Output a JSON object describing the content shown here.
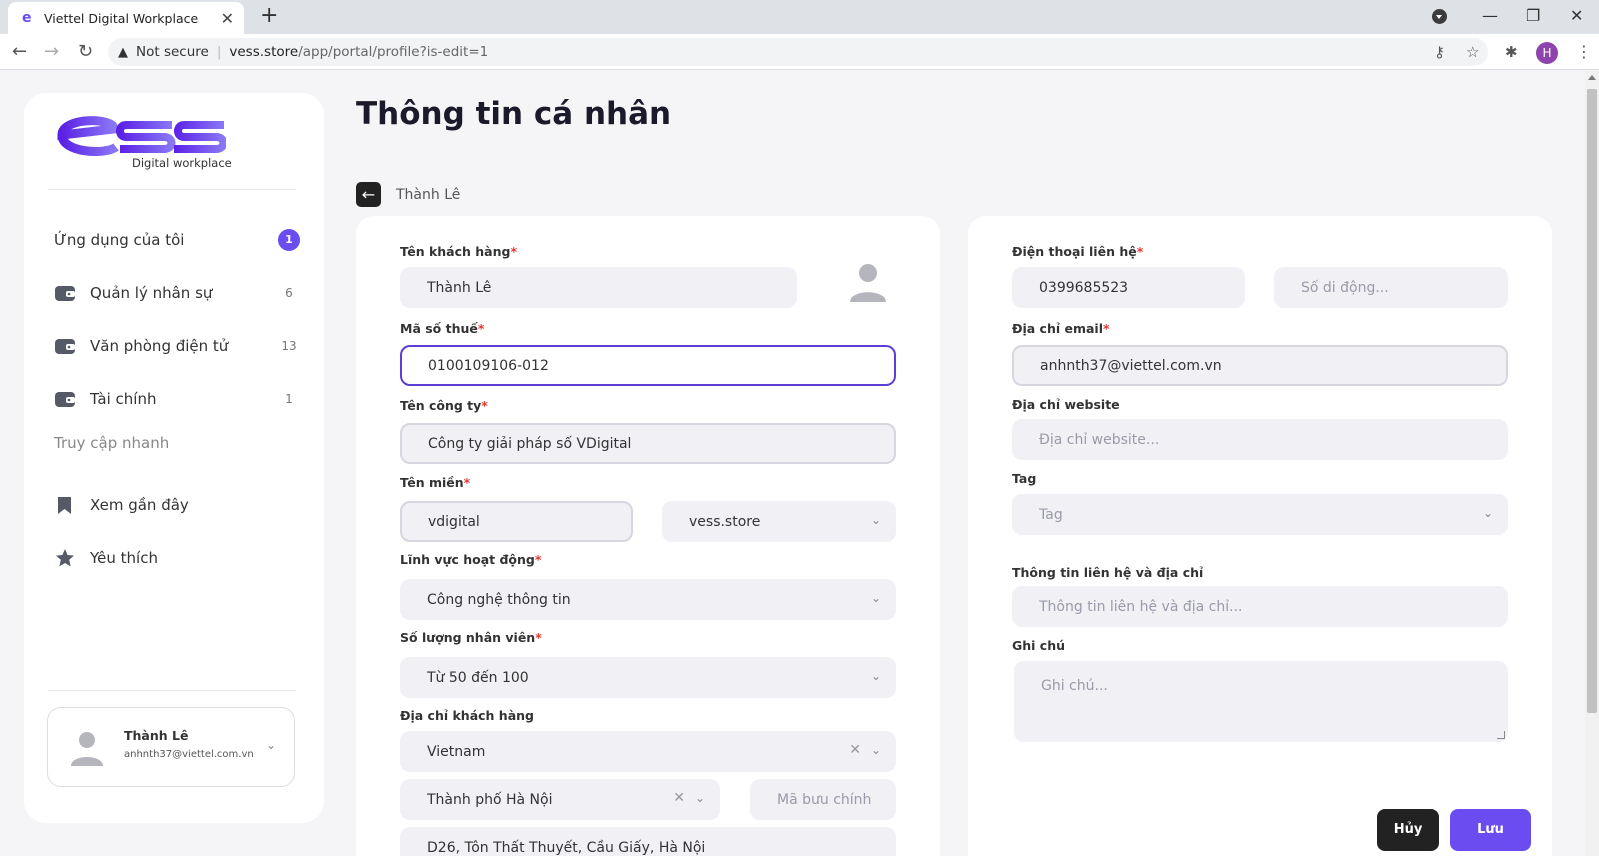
{
  "browser": {
    "tab_title": "Viettel Digital Workplace",
    "not_secure": "Not secure",
    "url_host": "vess.store",
    "url_path": "/app/portal/profile?is-edit=1",
    "profile_initial": "H"
  },
  "sidebar": {
    "logo_text": "ess",
    "logo_subtitle": "Digital workplace",
    "my_apps": {
      "label": "Ứng dụng của tôi",
      "badge": "1"
    },
    "apps": [
      {
        "label": "Quản lý nhân sự",
        "count": "6"
      },
      {
        "label": "Văn phòng điện tử",
        "count": "13"
      },
      {
        "label": "Tài chính",
        "count": "1"
      }
    ],
    "quick_access_label": "Truy cập nhanh",
    "quick": [
      {
        "label": "Xem gần đây"
      },
      {
        "label": "Yêu thích"
      }
    ],
    "user": {
      "name": "Thành Lê",
      "email": "anhnth37@viettel.com.vn"
    }
  },
  "page": {
    "title": "Thông tin cá nhân",
    "breadcrumb": "Thành Lê"
  },
  "form_left": {
    "customer_name": {
      "label": "Tên khách hàng",
      "value": "Thành Lê"
    },
    "tax_code": {
      "label": "Mã số thuế",
      "value": "0100109106-012"
    },
    "company_name": {
      "label": "Tên công ty",
      "value": "Công ty giải pháp số VDigital"
    },
    "domain": {
      "label": "Tên miền",
      "value": "vdigital",
      "suffix": "vess.store"
    },
    "field": {
      "label": "Lĩnh vực hoạt động",
      "value": "Công nghệ thông tin"
    },
    "employees": {
      "label": "Số lượng nhân viên",
      "value": "Từ 50 đến 100"
    },
    "address": {
      "label": "Địa chỉ khách hàng",
      "country": "Vietnam",
      "city": "Thành phố Hà Nội",
      "postal_placeholder": "Mã bưu chính",
      "street": "D26, Tôn Thất Thuyết, Cầu Giấy, Hà Nội"
    }
  },
  "form_right": {
    "phone": {
      "label": "Điện thoại liên hệ",
      "value": "0399685523",
      "mobile_placeholder": "Số di động..."
    },
    "email": {
      "label": "Địa chỉ email",
      "value": "anhnth37@viettel.com.vn"
    },
    "website": {
      "label": "Địa chỉ website",
      "placeholder": "Địa chỉ website..."
    },
    "tag": {
      "label": "Tag",
      "placeholder": "Tag"
    },
    "contact_info": {
      "label": "Thông tin liên hệ và địa chỉ",
      "placeholder": "Thông tin liên hệ và địa chỉ..."
    },
    "note": {
      "label": "Ghi chú",
      "placeholder": "Ghi chú..."
    }
  },
  "actions": {
    "cancel": "Hủy",
    "save": "Lưu"
  },
  "colors": {
    "accent": "#6a4cf0",
    "focus_border": "#5e3ed6",
    "required": "#e53935"
  }
}
